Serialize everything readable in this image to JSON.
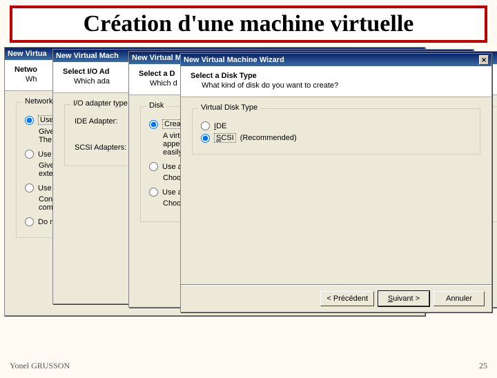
{
  "slide": {
    "title": "Création d'une machine virtuelle",
    "footer_author": "Yonel GRUSSON",
    "footer_page": "25"
  },
  "wizards": {
    "w1": {
      "titlebar": "New Virtua",
      "header_title": "Netwo",
      "header_sub": "Wh",
      "group_legend": "Network",
      "opt1": "Use",
      "opt1_desc1": "Give",
      "opt1_desc2": "The",
      "opt2": "Use",
      "opt2_desc1": "Give",
      "opt2_desc2": "exte",
      "opt3": "Use",
      "opt3_desc1": "Con",
      "opt3_desc2": "com",
      "opt4": "Do n"
    },
    "w2": {
      "titlebar": "New Virtual Mach",
      "header_title": "Select I/O Ad",
      "header_sub": "Which ada",
      "group_legend": "I/O adapter type",
      "row1": "IDE Adapter:",
      "row2": "SCSI Adapters:"
    },
    "w3": {
      "titlebar": "New Virtual Ma",
      "header_title": "Select a D",
      "header_sub": "Which d",
      "group_legend": "Disk",
      "opt1": "Create a",
      "opt1_desc1": "A virtual d",
      "opt1_desc2": "appear a",
      "opt1_desc3": "easily be",
      "opt2": "Use an e",
      "opt2_desc": "Choose t",
      "opt3": "Use a ph",
      "opt3_desc": "Choose t"
    },
    "w4": {
      "titlebar": "New Virtual Machine Wizard",
      "header_title": "Select a Disk Type",
      "header_sub": "What kind of disk do you want to create?",
      "group_legend": "Virtual Disk Type",
      "opt_ide": "IDE",
      "opt_scsi": "SCSI",
      "opt_scsi_hint": "(Recommended)",
      "btn_back": "< Précédent",
      "btn_next": "Suivant >",
      "btn_cancel": "Annuler"
    }
  }
}
